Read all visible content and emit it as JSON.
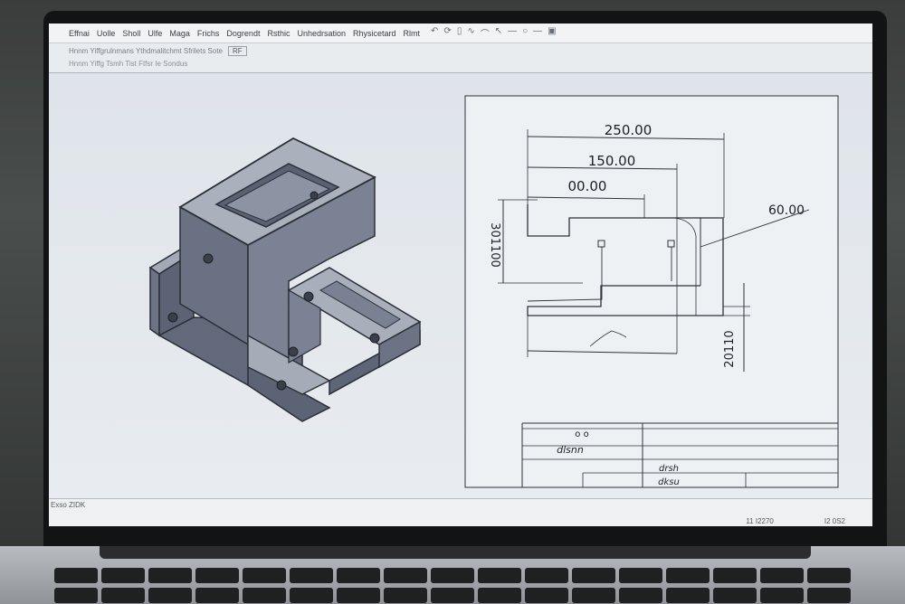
{
  "app": {
    "menu": [
      "Effnai",
      "Uolle",
      "Sholl",
      "Ulfe",
      "Maga",
      "Frichs",
      "Dogrendt",
      "Rsthic",
      "Unhedrsation",
      "Rhysicetard",
      "Rlmt"
    ],
    "toolbar_text": "Hnnm Yiffgrulnmans Ythdmalitchmt Sfrilets Sote",
    "toolbar_chip": "RF",
    "subtoolbar_text": "Hnnm Yiffg Tsmh Tist Ftfsr Ie Sondus",
    "status_left": "Exso ZIDK",
    "status_right": [
      "11 I2270",
      "I2 0S2"
    ]
  },
  "drawing": {
    "dim_top": "250.00",
    "dim_mid": "150.00",
    "dim_inner": "00.00",
    "dim_right": "60.00",
    "dim_left_vertical": "301100",
    "dim_right_vertical": "20110",
    "title_block": {
      "row1_marks": "o  o",
      "row2_label": "dlsnn",
      "row3_label": "drsh",
      "row4_label": "dksu"
    }
  },
  "colors": {
    "part_face_top": "#a9afbb",
    "part_face_side": "#6c7384",
    "part_face_dark": "#515869",
    "screen_bg": "#e9ecef"
  }
}
